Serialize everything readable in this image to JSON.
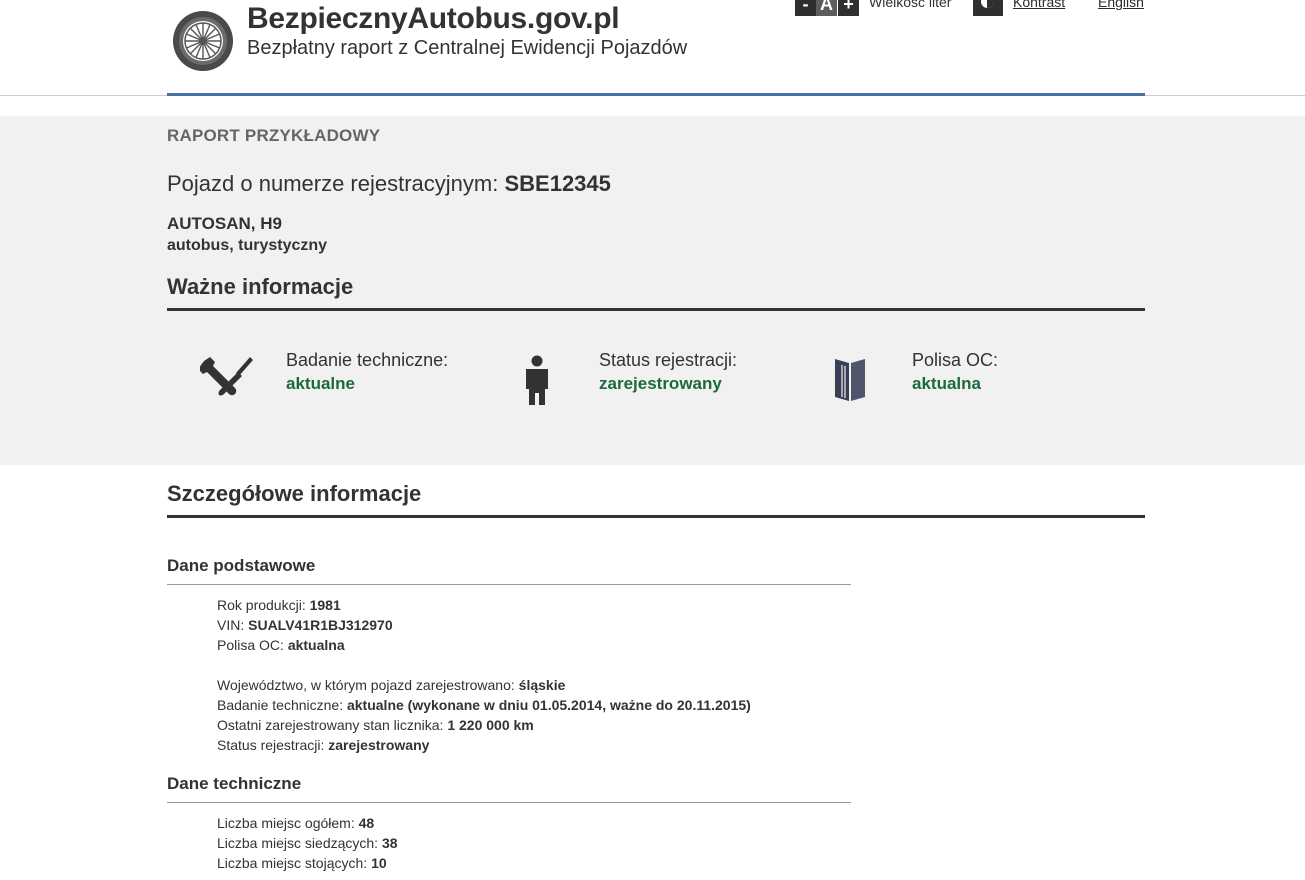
{
  "header": {
    "site_title": "BezpiecznyAutobus.gov.pl",
    "site_subtitle": "Bezpłatny raport z Centralnej Ewidencji Pojazdów",
    "font_size": {
      "decrease": "-",
      "reset": "A",
      "increase": "+",
      "label": "Wielkość liter"
    },
    "contrast_label": "Kontrast",
    "language_label": "English"
  },
  "summary": {
    "sample_label": "RAPORT PRZYKŁADOWY",
    "plate_prefix": "Pojazd o numerze rejestracyjnym: ",
    "plate_number": "SBE12345",
    "make_model": "AUTOSAN, H9",
    "vehicle_type": "autobus, turystyczny"
  },
  "important": {
    "heading": "Ważne informacje",
    "items": [
      {
        "icon": "wrench-screwdriver-icon",
        "title": "Badanie techniczne:",
        "value": "aktualne"
      },
      {
        "icon": "person-icon",
        "title": "Status rejestracji:",
        "value": "zarejestrowany"
      },
      {
        "icon": "document-icon",
        "title": "Polisa OC:",
        "value": "aktualna"
      }
    ]
  },
  "details": {
    "heading": "Szczegółowe informacje",
    "basic": {
      "heading": "Dane podstawowe",
      "rows_a": [
        {
          "label": "Rok produkcji: ",
          "value": "1981"
        },
        {
          "label": "VIN: ",
          "value": "SUALV41R1BJ312970"
        },
        {
          "label": "Polisa OC: ",
          "value": "aktualna"
        }
      ],
      "rows_b": [
        {
          "label": "Województwo, w którym pojazd zarejestrowano: ",
          "value": "śląskie"
        },
        {
          "label": "Badanie techniczne: ",
          "value": "aktualne (wykonane w dniu 01.05.2014, ważne do 20.11.2015)"
        },
        {
          "label": "Ostatni zarejestrowany stan licznika: ",
          "value": "1 220 000 km"
        },
        {
          "label": "Status rejestracji: ",
          "value": "zarejestrowany"
        }
      ]
    },
    "technical": {
      "heading": "Dane techniczne",
      "rows": [
        {
          "label": "Liczba miejsc ogółem: ",
          "value": "48"
        },
        {
          "label": "Liczba miejsc siedzących: ",
          "value": "38"
        },
        {
          "label": "Liczba miejsc stojących: ",
          "value": "10"
        }
      ]
    }
  },
  "colors": {
    "accent_rule": "#4a6fa5",
    "status_green": "#1b6b3a",
    "summary_bg": "#f1f1f1"
  }
}
